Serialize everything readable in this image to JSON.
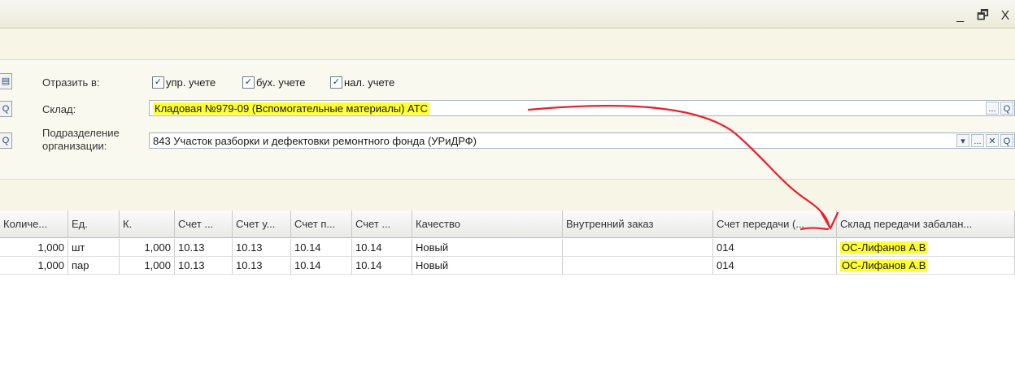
{
  "window": {
    "minimize": "_",
    "restore": "🗗",
    "close": "X"
  },
  "form": {
    "reflect_label": "Отразить в:",
    "checks": [
      {
        "label": "упр. учете",
        "checked": true
      },
      {
        "label": "бух. учете",
        "checked": true
      },
      {
        "label": "нал. учете",
        "checked": true
      }
    ],
    "warehouse_label": "Склад:",
    "warehouse_value": "Кладовая №979-09 (Вспомогательные материалы) АТС",
    "division_label_1": "Подразделение",
    "division_label_2": "организации:",
    "division_value": "843 Участок разборки и дефектовки ремонтного фонда (УРиДРФ)"
  },
  "buttons": {
    "ellipsis": "...",
    "search": "Q",
    "clear": "✕",
    "dropdown": "▾"
  },
  "table": {
    "columns": [
      "Количе...",
      "Ед.",
      "К.",
      "Счет ...",
      "Счет у...",
      "Счет п...",
      "Счет ...",
      "Качество",
      "Внутренний заказ",
      "Счет передачи (...",
      "Склад передачи забалан..."
    ],
    "rows": [
      [
        "1,000",
        "шт",
        "1,000",
        "10.13",
        "10.13",
        "10.14",
        "10.14",
        "Новый",
        "",
        "014",
        "ОС-Лифанов А.В"
      ],
      [
        "1,000",
        "пар",
        "1,000",
        "10.13",
        "10.13",
        "10.14",
        "10.14",
        "Новый",
        "",
        "014",
        "ОС-Лифанов А.В"
      ]
    ]
  },
  "colors": {
    "highlight": "#ffff33",
    "annotation": "#e8202a"
  }
}
